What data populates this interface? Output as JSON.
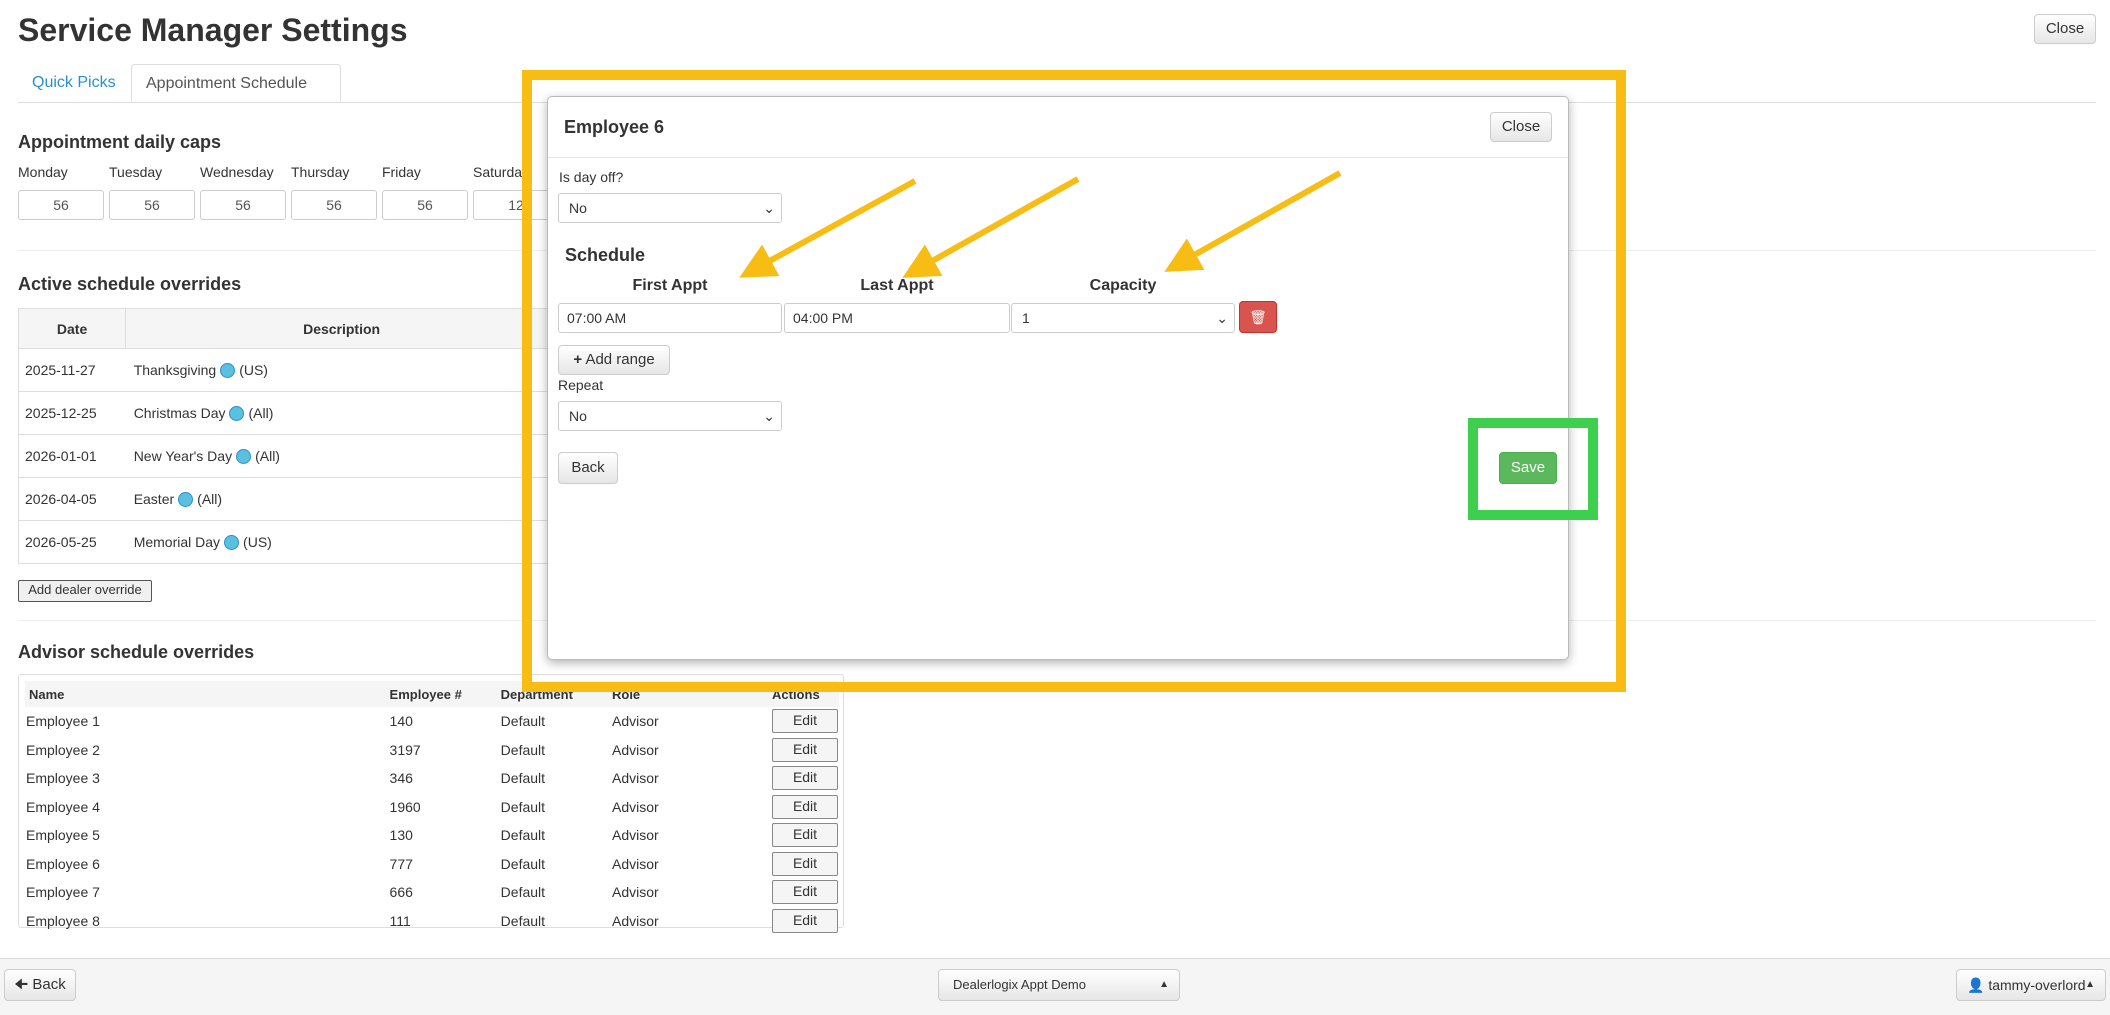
{
  "page": {
    "title": "Service Manager Settings",
    "close_label": "Close",
    "tabs": [
      {
        "label": "Quick Picks"
      },
      {
        "label": "Appointment Schedule"
      }
    ]
  },
  "daily_caps": {
    "title": "Appointment daily caps",
    "days": [
      {
        "label": "Monday",
        "value": "56"
      },
      {
        "label": "Tuesday",
        "value": "56"
      },
      {
        "label": "Wednesday",
        "value": "56"
      },
      {
        "label": "Thursday",
        "value": "56"
      },
      {
        "label": "Friday",
        "value": "56"
      },
      {
        "label": "Saturda",
        "value": "12"
      }
    ]
  },
  "active_overrides": {
    "title": "Active schedule overrides",
    "headers": {
      "date": "Date",
      "description": "Description"
    },
    "rows": [
      {
        "date": "2025-11-27",
        "name": "Thanksgiving",
        "scope": "(US)"
      },
      {
        "date": "2025-12-25",
        "name": "Christmas Day",
        "scope": "(All)"
      },
      {
        "date": "2026-01-01",
        "name": "New Year's Day",
        "scope": "(All)"
      },
      {
        "date": "2026-04-05",
        "name": "Easter",
        "scope": "(All)"
      },
      {
        "date": "2026-05-25",
        "name": "Memorial Day",
        "scope": "(US)"
      }
    ],
    "add_label": "Add dealer override"
  },
  "advisor_overrides": {
    "title": "Advisor schedule overrides",
    "headers": {
      "name": "Name",
      "employee": "Employee #",
      "department": "Department",
      "role": "Role",
      "actions": "Actions"
    },
    "edit_label": "Edit",
    "rows": [
      {
        "name": "Employee 1",
        "num": "140",
        "dept": "Default",
        "role": "Advisor"
      },
      {
        "name": "Employee 2",
        "num": "3197",
        "dept": "Default",
        "role": "Advisor"
      },
      {
        "name": "Employee 3",
        "num": "346",
        "dept": "Default",
        "role": "Advisor"
      },
      {
        "name": "Employee 4",
        "num": "1960",
        "dept": "Default",
        "role": "Advisor"
      },
      {
        "name": "Employee 5",
        "num": "130",
        "dept": "Default",
        "role": "Advisor"
      },
      {
        "name": "Employee 6",
        "num": "777",
        "dept": "Default",
        "role": "Advisor"
      },
      {
        "name": "Employee 7",
        "num": "666",
        "dept": "Default",
        "role": "Advisor"
      },
      {
        "name": "Employee 8",
        "num": "111",
        "dept": "Default",
        "role": "Advisor"
      }
    ]
  },
  "modal": {
    "title": "Employee 6",
    "close_label": "Close",
    "day_off_label": "Is day off?",
    "day_off_value": "No",
    "schedule_title": "Schedule",
    "col_first": "First Appt",
    "col_last": "Last Appt",
    "col_capacity": "Capacity",
    "first_value": "07:00 AM",
    "last_value": "04:00 PM",
    "capacity_value": "1",
    "add_range_label": "Add range",
    "repeat_label": "Repeat",
    "repeat_value": "No",
    "back_label": "Back",
    "save_label": "Save"
  },
  "footer": {
    "back_label": "Back",
    "dealer": "Dealerlogix Appt Demo",
    "user": "tammy-overlord"
  },
  "colors": {
    "highlight_yellow": "#f7bd14",
    "highlight_green": "#3fcf4f",
    "save": "#5cb85c",
    "delete": "#d9534f",
    "link": "#2a8fd0"
  }
}
